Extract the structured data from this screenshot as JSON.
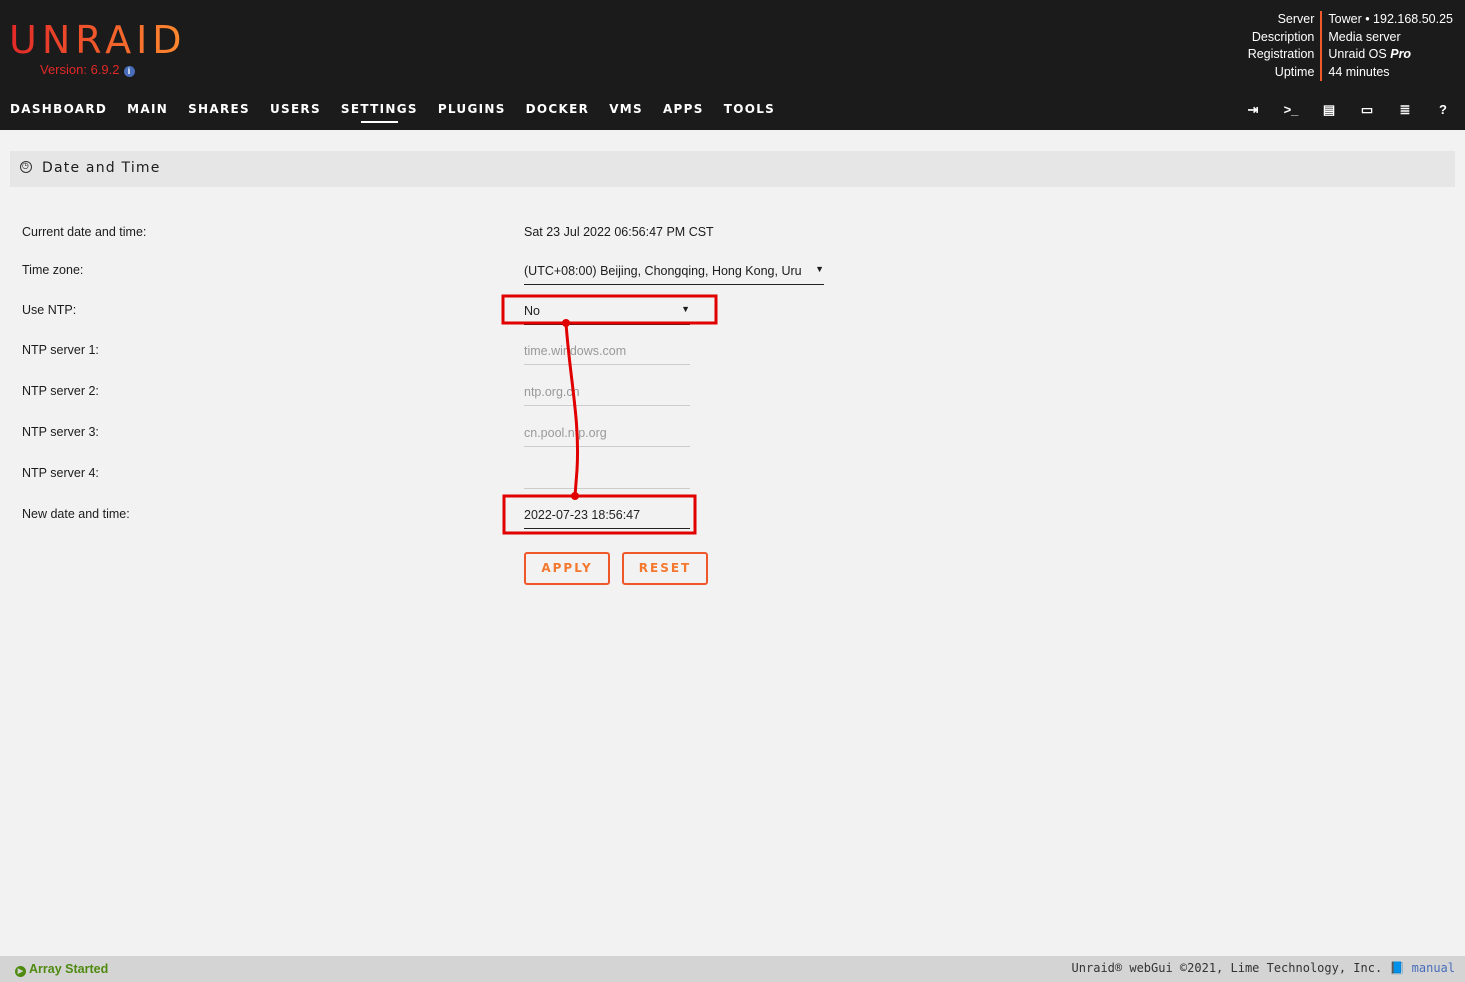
{
  "header": {
    "logo": "UNRAID",
    "version": "Version: 6.9.2",
    "server_info": {
      "labels": [
        "Server",
        "Description",
        "Registration",
        "Uptime"
      ],
      "server": "Tower • 192.168.50.25",
      "description": "Media server",
      "registration": "Unraid OS ",
      "registration_em": "Pro",
      "uptime": "44 minutes"
    }
  },
  "nav": {
    "items": [
      "DASHBOARD",
      "MAIN",
      "SHARES",
      "USERS",
      "SETTINGS",
      "PLUGINS",
      "DOCKER",
      "VMS",
      "APPS",
      "TOOLS"
    ],
    "active": "SETTINGS",
    "icons": [
      "logout-icon",
      "terminal-icon",
      "feedback-icon",
      "vnc-icon",
      "log-icon",
      "help-icon"
    ]
  },
  "page": {
    "title": "Date and Time",
    "fields": {
      "current_label": "Current date and time:",
      "current_value": "Sat 23 Jul 2022 06:56:47 PM CST",
      "tz_label": "Time zone:",
      "tz_value": "(UTC+08:00) Beijing, Chongqing, Hong Kong, Uru",
      "ntp_label": "Use NTP:",
      "ntp_value": "No",
      "ntp1_label": "NTP server 1:",
      "ntp1_value": "time.windows.com",
      "ntp2_label": "NTP server 2:",
      "ntp2_value": "ntp.org.cn",
      "ntp3_label": "NTP server 3:",
      "ntp3_value": "cn.pool.ntp.org",
      "ntp4_label": "NTP server 4:",
      "ntp4_value": "",
      "new_label": "New date and time:",
      "new_value": "2022-07-23 18:56:47"
    },
    "apply": "APPLY",
    "reset": "RESET"
  },
  "footer": {
    "status": "Array Started",
    "copyright": "Unraid® webGui ©2021, Lime Technology, Inc.",
    "manual": "manual"
  },
  "colors": {
    "accent": "#f15a2c",
    "header_bg": "#1c1b1b",
    "status_green": "#4f8a10",
    "annotation": "#e00000"
  }
}
